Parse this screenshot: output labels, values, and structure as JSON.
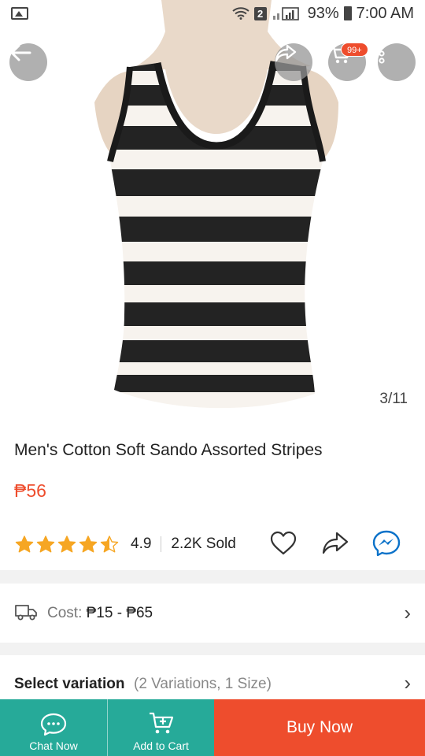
{
  "status_bar": {
    "sim": "2",
    "battery": "93%",
    "time": "7:00 AM"
  },
  "header": {
    "cart_badge": "99+"
  },
  "gallery": {
    "counter": "3/11"
  },
  "product": {
    "title": "Men's Cotton Soft Sando Assorted Stripes",
    "price": "₱56",
    "rating": "4.9",
    "stars": 4.5,
    "sold": "2.2K Sold"
  },
  "shipping": {
    "label": "Cost: ",
    "range": "₱15 - ₱65"
  },
  "variation": {
    "label": "Select variation",
    "detail": "(2 Variations, 1 Size)"
  },
  "bottom_bar": {
    "chat_label": "Chat Now",
    "cart_label": "Add to Cart",
    "buy_label": "Buy Now"
  },
  "colors": {
    "brand": "#ee4d2d",
    "teal": "#26aa99",
    "star": "#f6a623"
  }
}
